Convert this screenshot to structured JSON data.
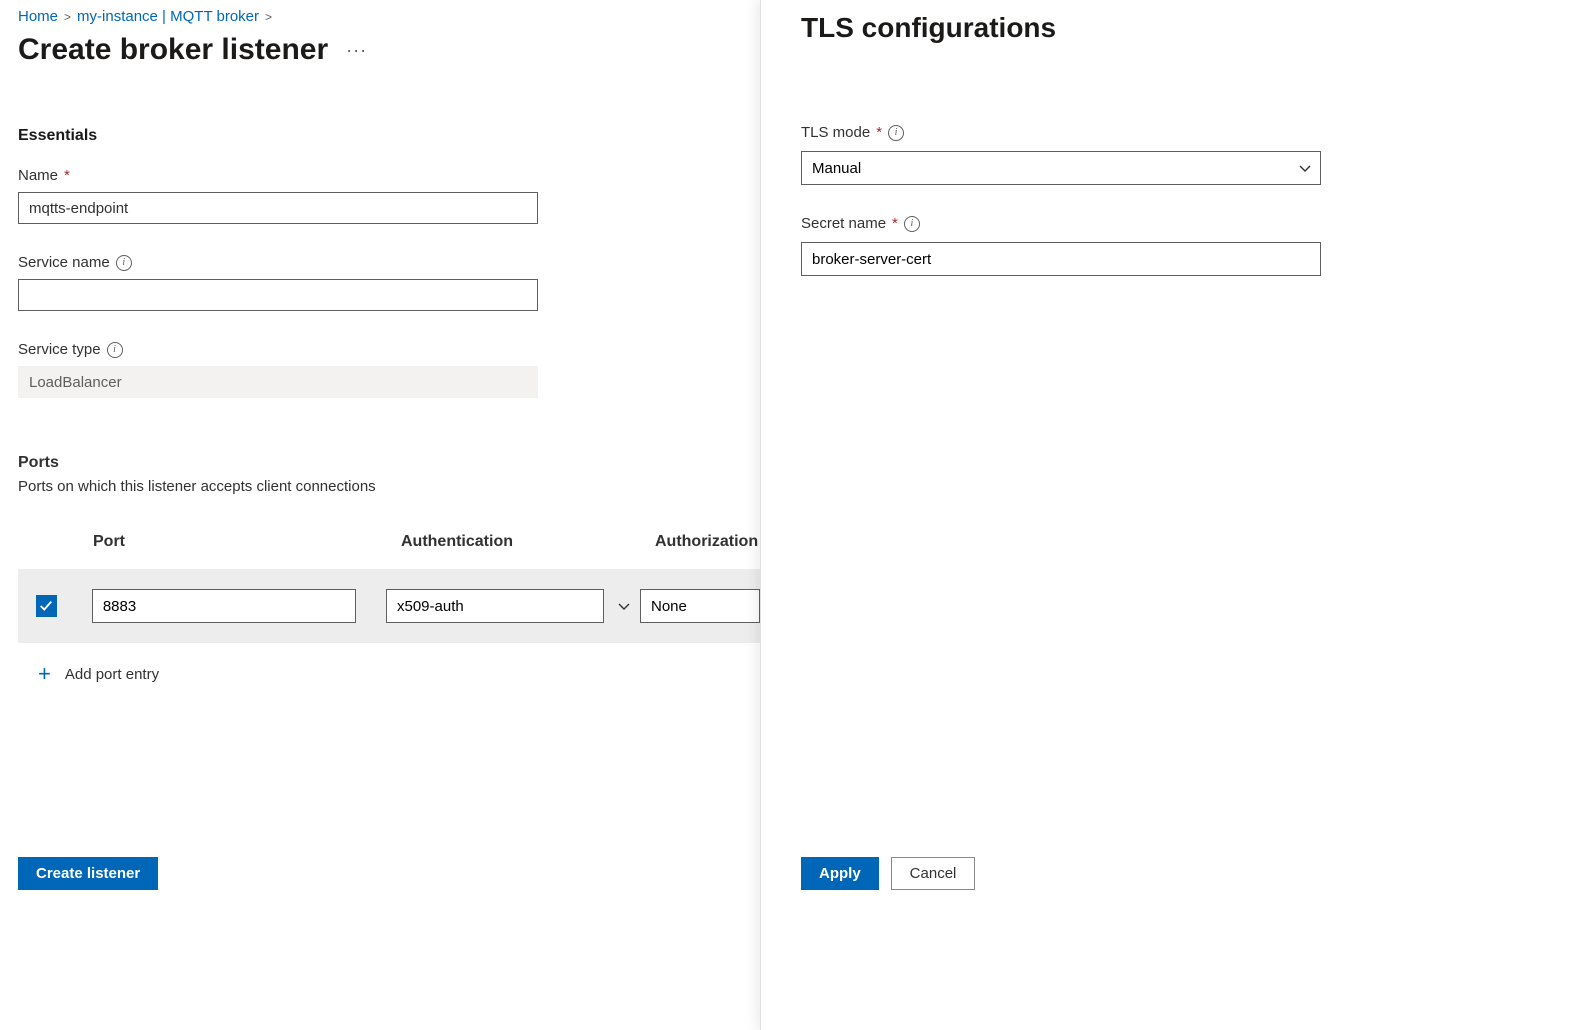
{
  "breadcrumb": {
    "home": "Home",
    "instance": "my-instance | MQTT broker"
  },
  "page": {
    "title": "Create broker listener"
  },
  "essentials": {
    "heading": "Essentials",
    "name_label": "Name",
    "name_value": "mqtts-endpoint",
    "service_name_label": "Service name",
    "service_name_value": "",
    "service_type_label": "Service type",
    "service_type_value": "LoadBalancer"
  },
  "ports": {
    "heading": "Ports",
    "description": "Ports on which this listener accepts client connections",
    "columns": {
      "port": "Port",
      "auth": "Authentication",
      "authz": "Authorization"
    },
    "rows": [
      {
        "checked": true,
        "port": "8883",
        "auth": "x509-auth",
        "authz": "None"
      }
    ],
    "add_label": "Add port entry"
  },
  "footer": {
    "create": "Create listener"
  },
  "panel": {
    "title": "TLS configurations",
    "tls_mode_label": "TLS mode",
    "tls_mode_value": "Manual",
    "secret_name_label": "Secret name",
    "secret_name_value": "broker-server-cert",
    "apply": "Apply",
    "cancel": "Cancel"
  }
}
